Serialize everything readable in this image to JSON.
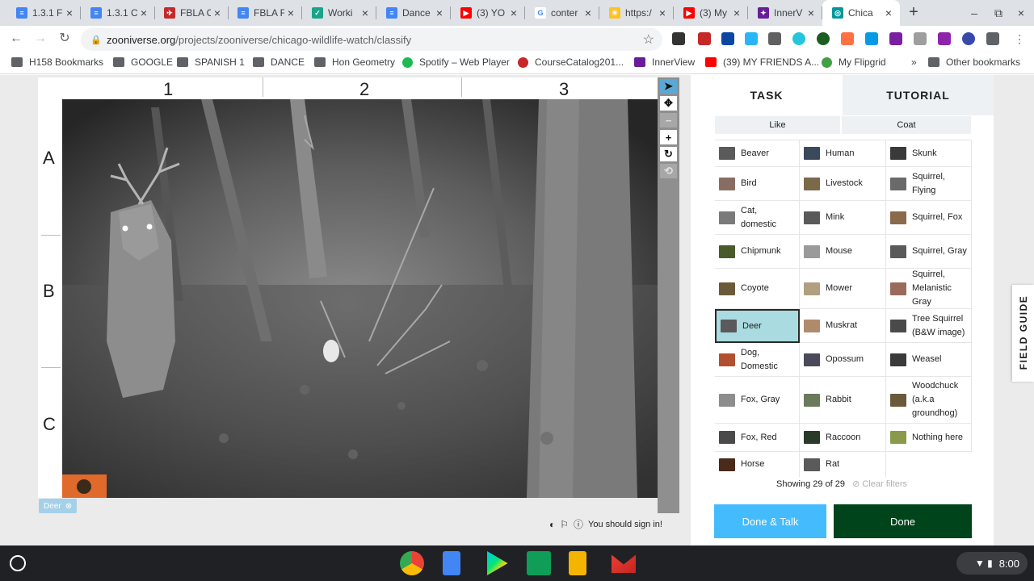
{
  "browser": {
    "tabs": [
      {
        "title": "1.3.1 F",
        "icon": "docs-icon",
        "color": "#4285f4",
        "glyph": "≡"
      },
      {
        "title": "1.3.1 C",
        "icon": "docs-icon",
        "color": "#4285f4",
        "glyph": "≡"
      },
      {
        "title": "FBLA C",
        "icon": "fbla-icon",
        "color": "#c62828",
        "glyph": "✈"
      },
      {
        "title": "FBLA F",
        "icon": "docs-icon",
        "color": "#4285f4",
        "glyph": "≡"
      },
      {
        "title": "Worki",
        "icon": "shield-check-icon",
        "color": "#17a589",
        "glyph": "✓"
      },
      {
        "title": "Dance",
        "icon": "docs-icon",
        "color": "#4285f4",
        "glyph": "≡"
      },
      {
        "title": "(3) YO",
        "icon": "youtube-icon",
        "color": "#ff0000",
        "glyph": "▶"
      },
      {
        "title": "conter",
        "icon": "google-icon",
        "color": "#ffffff",
        "glyph": "G"
      },
      {
        "title": "https:/",
        "icon": "walmart-icon",
        "color": "#ffc220",
        "glyph": "✳"
      },
      {
        "title": "(3) My",
        "icon": "youtube-icon",
        "color": "#ff0000",
        "glyph": "▶"
      },
      {
        "title": "InnerV",
        "icon": "innerview-icon",
        "color": "#6a1b9a",
        "glyph": "✦"
      },
      {
        "title": "Chica",
        "icon": "zooniverse-icon",
        "color": "#00979d",
        "glyph": "◎"
      }
    ],
    "url_host": "zooniverse.org",
    "url_path": "/projects/zooniverse/chicago-wildlife-watch/classify"
  },
  "bookmarks": [
    {
      "label": "H158 Bookmarks",
      "icon": "bookmarks-icon"
    },
    {
      "label": "GOOGLE",
      "icon": "folder-icon"
    },
    {
      "label": "SPANISH 1",
      "icon": "folder-icon"
    },
    {
      "label": "DANCE",
      "icon": "folder-icon"
    },
    {
      "label": "Hon Geometry",
      "icon": "folder-icon"
    },
    {
      "label": "Spotify – Web Player",
      "icon": "spotify-icon"
    },
    {
      "label": "CourseCatalog201...",
      "icon": "coursecatalog-icon"
    },
    {
      "label": "InnerView",
      "icon": "innerview-icon"
    },
    {
      "label": "(39) MY FRIENDS A...",
      "icon": "youtube-icon"
    },
    {
      "label": "My Flipgrid",
      "icon": "flipgrid-icon"
    },
    {
      "label": "»",
      "icon": "more-icon"
    },
    {
      "label": "Other bookmarks",
      "icon": "folder-icon"
    }
  ],
  "subject": {
    "columns": [
      "1",
      "2",
      "3"
    ],
    "rows": [
      "A",
      "B",
      "C"
    ],
    "tag": "Deer"
  },
  "meta": {
    "sign_in": "You should sign in!"
  },
  "task": {
    "tab_task": "TASK",
    "tab_tutorial": "TUTORIAL",
    "filters": [
      "Like",
      "Coat"
    ],
    "choices": [
      [
        {
          "label": "Beaver",
          "thumb": "#5a5a5a"
        },
        {
          "label": "Bird",
          "thumb": "#8a6d62"
        },
        {
          "label": "Cat, domestic",
          "thumb": "#7a7a7a"
        },
        {
          "label": "Chipmunk",
          "thumb": "#4a5a2a"
        },
        {
          "label": "Coyote",
          "thumb": "#6b5a3a"
        },
        {
          "label": "Deer",
          "thumb": "#5a5a5a"
        },
        {
          "label": "Dog, Domestic",
          "thumb": "#b05030"
        },
        {
          "label": "Fox, Gray",
          "thumb": "#8d8d8d"
        },
        {
          "label": "Fox, Red",
          "thumb": "#4a4a4a"
        },
        {
          "label": "Horse",
          "thumb": "#4a2a1a"
        }
      ],
      [
        {
          "label": "Human",
          "thumb": "#3a4a5a"
        },
        {
          "label": "Livestock",
          "thumb": "#7a6a4a"
        },
        {
          "label": "Mink",
          "thumb": "#5a5a5a"
        },
        {
          "label": "Mouse",
          "thumb": "#9a9a9a"
        },
        {
          "label": "Mower",
          "thumb": "#b0a080"
        },
        {
          "label": "Muskrat",
          "thumb": "#b08a6a"
        },
        {
          "label": "Opossum",
          "thumb": "#4a4a5a"
        },
        {
          "label": "Rabbit",
          "thumb": "#6a7a5a"
        },
        {
          "label": "Raccoon",
          "thumb": "#2a3a2a"
        },
        {
          "label": "Rat",
          "thumb": "#5a5a5a"
        }
      ],
      [
        {
          "label": "Skunk",
          "thumb": "#3a3a3a"
        },
        {
          "label": "Squirrel, Flying",
          "thumb": "#6a6a6a"
        },
        {
          "label": "Squirrel, Fox",
          "thumb": "#8a6a4a"
        },
        {
          "label": "Squirrel, Gray",
          "thumb": "#5a5a5a"
        },
        {
          "label": "Squirrel, Melanistic Gray",
          "thumb": "#9a6a5a"
        },
        {
          "label": "Tree Squirrel (B&W image)",
          "thumb": "#4a4a4a"
        },
        {
          "label": "Weasel",
          "thumb": "#3a3a3a"
        },
        {
          "label": "Woodchuck (a.k.a groundhog)",
          "thumb": "#6a5a3a"
        },
        {
          "label": "Nothing here",
          "thumb": "#8a9a4a"
        }
      ]
    ],
    "showing": "Showing 29 of 29",
    "clear_filters": "Clear filters",
    "done_talk": "Done & Talk",
    "done": "Done",
    "field_guide": "FIELD GUIDE"
  },
  "shelf": {
    "apps": [
      "chrome-icon",
      "google-docs-icon",
      "play-store-icon",
      "google-classroom-icon",
      "google-slides-icon",
      "gmail-icon"
    ],
    "time": "8:00"
  }
}
